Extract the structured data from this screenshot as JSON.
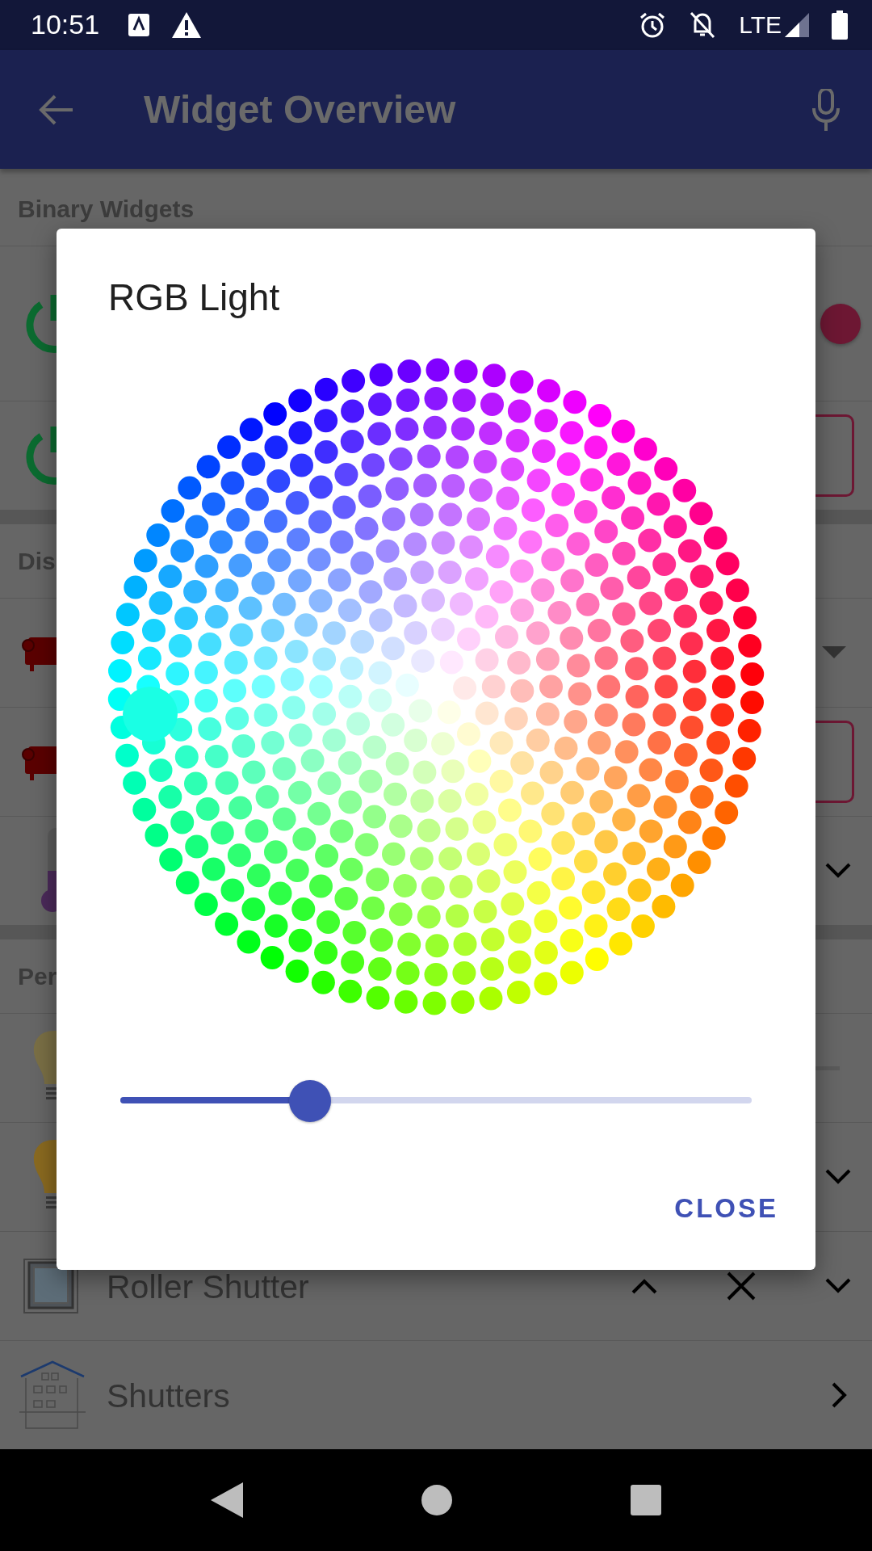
{
  "status_bar": {
    "time": "10:51",
    "network": "LTE"
  },
  "app_bar": {
    "title": "Widget Overview"
  },
  "sections": [
    {
      "header": "Binary Widgets",
      "rows": [
        {
          "kind": "switch",
          "on": true
        },
        {
          "kind": "pushbutton"
        }
      ]
    },
    {
      "header": "Dis",
      "rows": [
        {
          "kind": "selection"
        },
        {
          "kind": "mapbutton"
        },
        {
          "kind": "setpoint"
        }
      ]
    },
    {
      "header": "Per",
      "rows": [
        {
          "kind": "slider"
        },
        {
          "kind": "colorpicker"
        },
        {
          "kind": "rollershutter",
          "label": "Roller Shutter"
        },
        {
          "kind": "group",
          "label": "Shutters"
        }
      ]
    }
  ],
  "dialog": {
    "title": "RGB Light",
    "slider": {
      "level": 0.3
    },
    "buttons": [
      "CLOSE"
    ]
  }
}
